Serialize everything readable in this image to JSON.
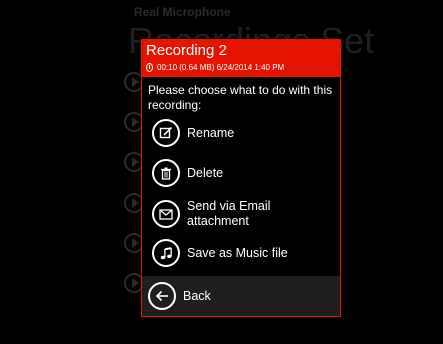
{
  "background": {
    "app_title": "Real Microphone",
    "page_title": "Recordings Set"
  },
  "dialog": {
    "title": "Recording 2",
    "meta": "00:10  (0.64 MB) 6/24/2014  1:40 PM",
    "message": "Please choose what to do with this recording:",
    "options": [
      {
        "label": "Rename",
        "icon": "rename-icon"
      },
      {
        "label": "Delete",
        "icon": "trash-icon"
      },
      {
        "label": "Send via Email attachment",
        "icon": "email-icon"
      },
      {
        "label": "Save as Music file",
        "icon": "music-note-icon"
      }
    ],
    "back_label": "Back"
  },
  "colors": {
    "accent": "#e51400",
    "app_bar": "#1f1f1f"
  }
}
